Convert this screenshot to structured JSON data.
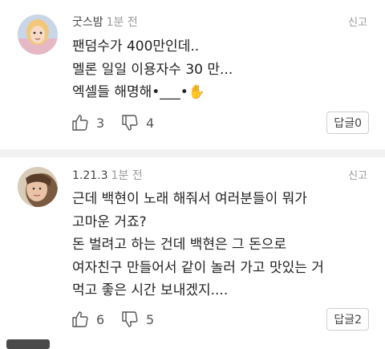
{
  "comments": [
    {
      "author": "굿스밤",
      "time": "1분 전",
      "report": "신고",
      "lines": [
        "팬덤수가 400만인데..",
        "멜론 일일 이용자수 30 만...",
        "엑셀들 해명해•___•✋"
      ],
      "likes": "3",
      "dislikes": "4",
      "reply": "답글0"
    },
    {
      "author": "1.21.3",
      "time": "1분 전",
      "report": "신고",
      "lines": [
        "근데 백현이 노래 해줘서 여러분들이 뭐가",
        "고마운 거죠?",
        "돈 벌려고 하는 건데 백현은 그 돈으로",
        "여자친구 만들어서 같이 놀러 가고 맛있는 거",
        "먹고 좋은 시간 보내겠지...."
      ],
      "likes": "6",
      "dislikes": "5",
      "reply": "답글2"
    }
  ],
  "icons": {
    "like": "thumbs-up-icon",
    "dislike": "thumbs-down-icon"
  },
  "colors": {
    "divider": "#f1f1f1",
    "meta": "#9a9a9a",
    "text": "#222222"
  }
}
